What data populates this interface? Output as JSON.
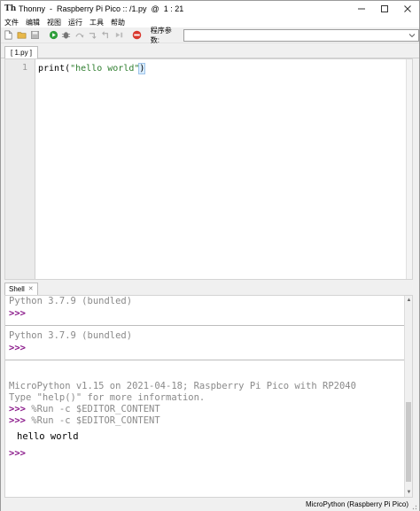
{
  "window": {
    "title": "Thonny  -  Raspberry Pi Pico :: /1.py  @  1 : 21",
    "app_icon_text": "Th",
    "controls": [
      "minimize",
      "maximize",
      "close"
    ]
  },
  "menu": [
    "文件",
    "编辑",
    "视图",
    "运行",
    "工具",
    "帮助"
  ],
  "toolbar": {
    "buttons": [
      "new-file",
      "open-file",
      "save-file",
      "run",
      "debug",
      "step-over",
      "step-into",
      "step-out",
      "resume",
      "stop"
    ],
    "args_label": "程序参数:",
    "args_value": ""
  },
  "editor": {
    "tab_label": "[ 1.py ]",
    "line_number": "1",
    "code_prefix": "print(",
    "code_string": "\"hello world\"",
    "code_suffix": ")"
  },
  "shell": {
    "tab_label": "Shell",
    "lines": [
      {
        "kind": "gray",
        "text": "Python 3.7.9 (bundled)"
      },
      {
        "kind": "prompt",
        "text": ">>>"
      },
      {
        "kind": "gray",
        "text": "Python 3.7.9 (bundled)"
      },
      {
        "kind": "prompt",
        "text": ">>>"
      },
      {
        "kind": "gray",
        "text": "MicroPython v1.15 on 2021-04-18; Raspberry Pi Pico with RP2040"
      },
      {
        "kind": "gray",
        "text": "Type \"help()\" for more information."
      },
      {
        "kind": "gray",
        "text": "%Run -c $EDITOR_CONTENT"
      },
      {
        "kind": "gray",
        "text": "%Run -c $EDITOR_CONTENT"
      },
      {
        "kind": "out",
        "text": "hello world"
      },
      {
        "kind": "prompt",
        "text": ">>>"
      }
    ]
  },
  "status": {
    "interpreter": "MicroPython (Raspberry Pi Pico)"
  },
  "colors": {
    "prompt": "#8b1a8b",
    "string": "#2d7d2d",
    "gray_text": "#8a8a8a",
    "stop_red": "#d9382e",
    "run_green": "#2e9e3a"
  }
}
